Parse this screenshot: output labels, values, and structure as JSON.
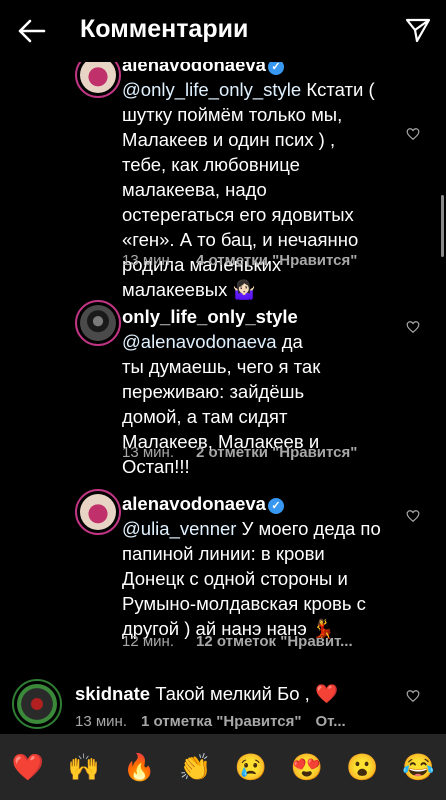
{
  "header": {
    "title": "Комментарии",
    "back_icon": "arrow-left-icon",
    "share_icon": "paper-plane-icon"
  },
  "comments": [
    {
      "username": "alenavodonaeva",
      "verified": true,
      "mention": "@only_life_only_style",
      "text": "Кстати ( шутку поймём только мы, Малакеев и один псих ) , тебе, как любовнице малакеева, надо остерегаться его ядовитых «ген». А то бац, и нечаянно родила маленьких малакеевых 🤷🏻‍♀️",
      "time": "13 мин.",
      "likes": "4 отметки \"Нравится\""
    },
    {
      "username": "only_life_only_style",
      "verified": false,
      "mention": "@alenavodonaeva",
      "text": "да ты думаешь, чего я так переживаю: зайдёшь домой, а там сидят Малакеев, Малакеев и Остап!!!",
      "time": "13 мин.",
      "likes": "2 отметки \"Нравится\""
    },
    {
      "username": "alenavodonaeva",
      "verified": true,
      "mention": "@ulia_venner",
      "text": "У моего деда по папиной линии: в крови Донецк с одной стороны и Румыно-молдавская кровь с другой ) ай нанэ нанэ 💃",
      "time": "12 мин.",
      "likes": "12 отметок \"Нравит..."
    },
    {
      "username": "skidnate",
      "verified": false,
      "text": "Такой мелкий Бо , ❤️",
      "time": "13 мин.",
      "likes": "1 отметка \"Нравится\"",
      "reply": "От..."
    }
  ],
  "reactions": [
    "❤️",
    "🙌",
    "🔥",
    "👏",
    "😢",
    "😍",
    "😮",
    "😂"
  ],
  "colors": {
    "background": "#000000",
    "meta": "#a8a8a8",
    "verified": "#3897f0",
    "story_ring": "#c13584",
    "emoji_bar": "#262626"
  }
}
